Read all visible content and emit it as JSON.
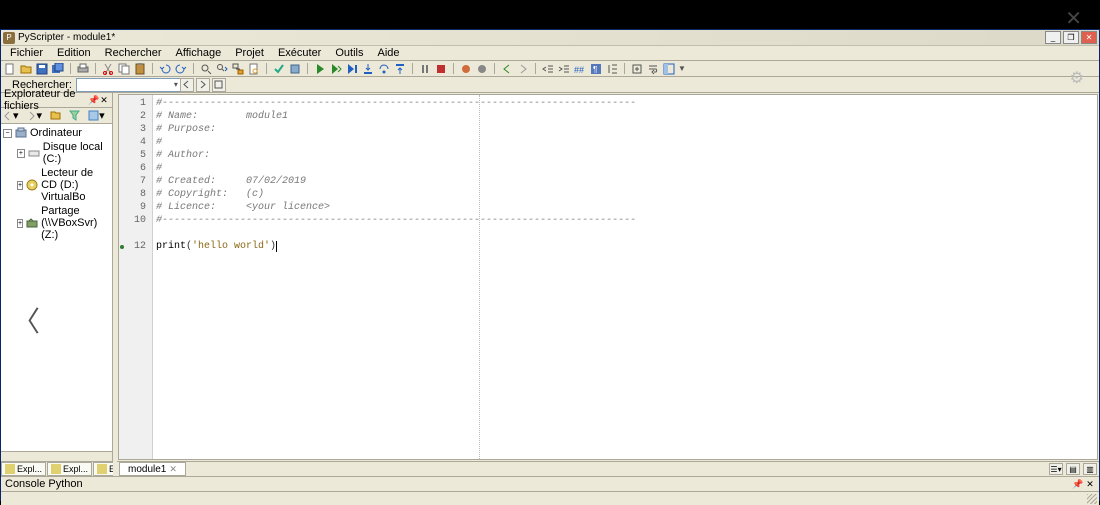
{
  "title": "PyScripter - module1*",
  "menu": [
    "Fichier",
    "Edition",
    "Rechercher",
    "Affichage",
    "Projet",
    "Exécuter",
    "Outils",
    "Aide"
  ],
  "search_label": "Rechercher:",
  "search_value": "",
  "sidebar": {
    "title": "Explorateur de fichiers",
    "tabs": [
      "Expl...",
      "Expl...",
      "Expl..."
    ],
    "tree": {
      "root": "Ordinateur",
      "items": [
        {
          "label": "Disque local (C:)"
        },
        {
          "label": "Lecteur de CD (D:) VirtualBo"
        },
        {
          "label": "Partage (\\\\VBoxSvr) (Z:)"
        }
      ]
    }
  },
  "editor": {
    "tab_label": "module1",
    "gutter": [
      "1",
      "2",
      "3",
      "4",
      "5",
      "6",
      "7",
      "8",
      "9",
      "10",
      "",
      "12"
    ],
    "lines": [
      {
        "cls": "cm-comment",
        "text": "#-------------------------------------------------------------------------------"
      },
      {
        "cls": "cm-comment",
        "text": "# Name:        module1"
      },
      {
        "cls": "cm-comment",
        "text": "# Purpose:"
      },
      {
        "cls": "cm-comment",
        "text": "#"
      },
      {
        "cls": "cm-comment",
        "text": "# Author:"
      },
      {
        "cls": "cm-comment",
        "text": "#"
      },
      {
        "cls": "cm-comment",
        "text": "# Created:     07/02/2019"
      },
      {
        "cls": "cm-comment",
        "text": "# Copyright:   (c)"
      },
      {
        "cls": "cm-comment",
        "text": "# Licence:     <your licence>"
      },
      {
        "cls": "cm-comment",
        "text": "#-------------------------------------------------------------------------------"
      },
      {
        "cls": "",
        "text": ""
      },
      {
        "cls": "",
        "text": ""
      }
    ],
    "code_keyword": "print",
    "code_string": "'hello world'",
    "code_paren_open": "(",
    "code_paren_close": ")"
  },
  "console_title": "Console Python"
}
